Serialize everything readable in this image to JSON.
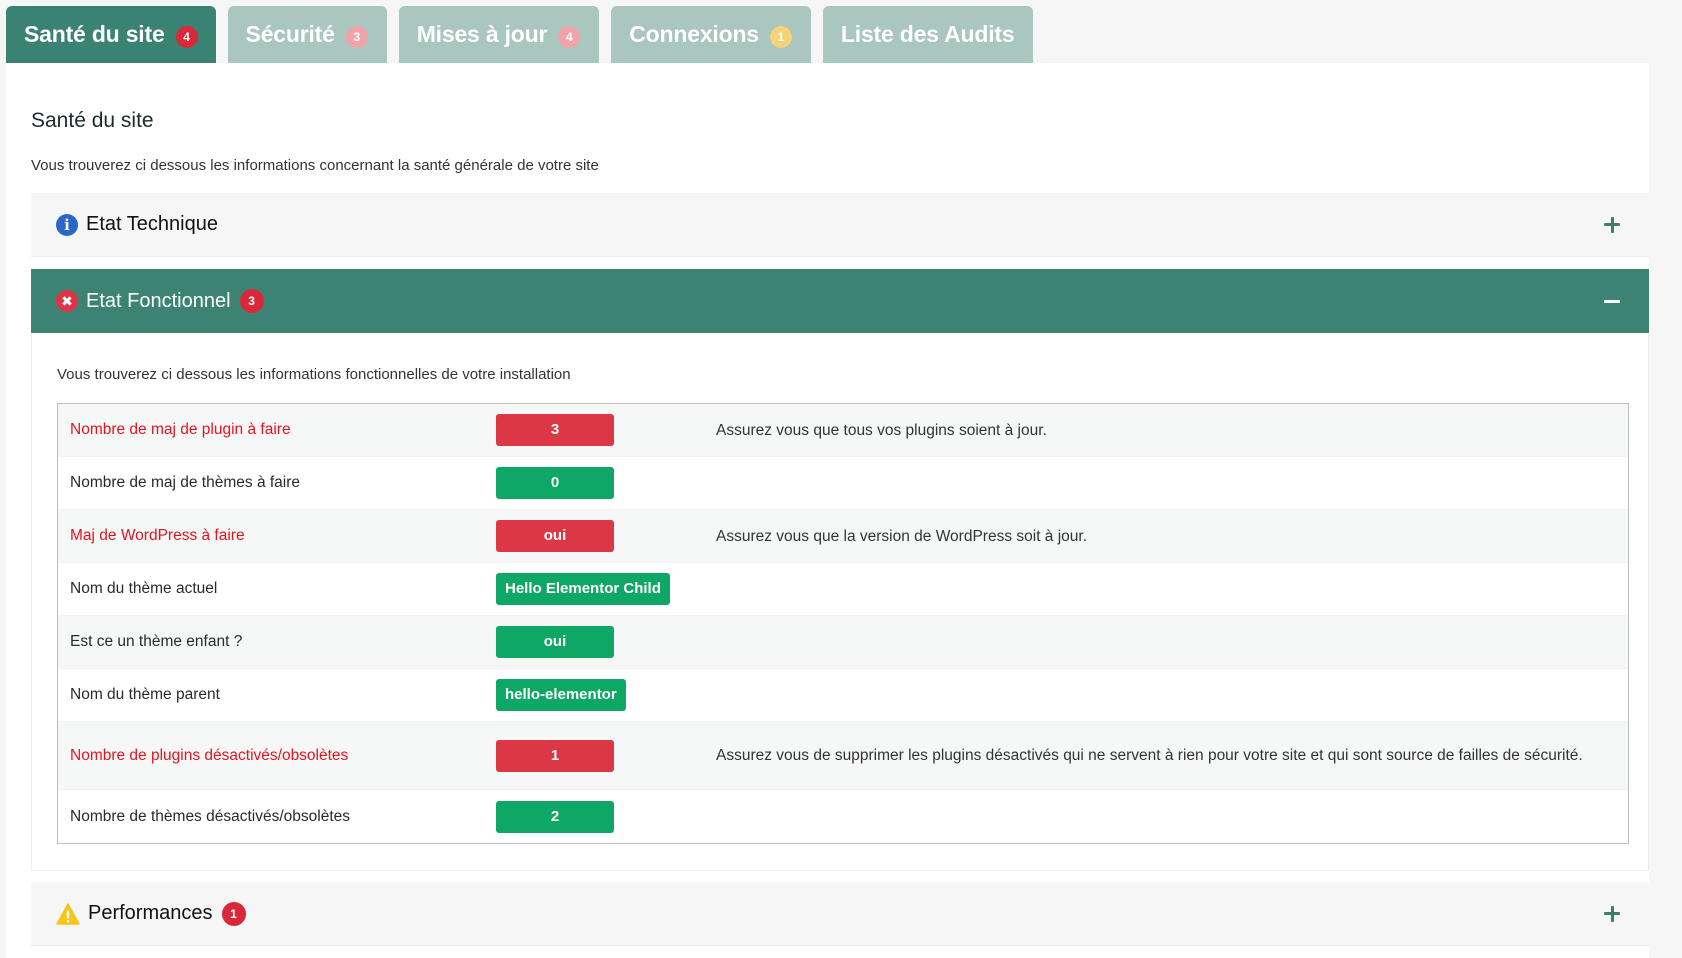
{
  "tabs": [
    {
      "label": "Santé du site",
      "badge": "4",
      "badge_style": "red",
      "active": true
    },
    {
      "label": "Sécurité",
      "badge": "3",
      "badge_style": "pink",
      "active": false
    },
    {
      "label": "Mises à jour",
      "badge": "4",
      "badge_style": "pink",
      "active": false
    },
    {
      "label": "Connexions",
      "badge": "1",
      "badge_style": "yellow",
      "active": false
    },
    {
      "label": "Liste des Audits",
      "badge": "",
      "badge_style": "",
      "active": false
    }
  ],
  "page": {
    "title": "Santé du site",
    "description": "Vous trouverez ci dessous les informations concernant la santé générale de votre site"
  },
  "sections": {
    "technique": {
      "title": "Etat Technique",
      "icon": "info-icon",
      "expanded": false
    },
    "fonctionnel": {
      "title": "Etat Fonctionnel",
      "icon": "error-icon",
      "badge": "3",
      "expanded": true,
      "description": "Vous trouverez ci dessous les informations fonctionnelles de votre installation",
      "rows": [
        {
          "label": "Nombre de maj de plugin à faire",
          "value": "3",
          "status": "red",
          "note": "Assurez vous que tous vos plugins soient à jour."
        },
        {
          "label": "Nombre de maj de thèmes à faire",
          "value": "0",
          "status": "green",
          "note": ""
        },
        {
          "label": "Maj de WordPress à faire",
          "value": "oui",
          "status": "red",
          "note": "Assurez vous que la version de WordPress soit à jour."
        },
        {
          "label": "Nom du thème actuel",
          "value": "Hello Elementor Child",
          "status": "green",
          "note": ""
        },
        {
          "label": "Est ce un thème enfant ?",
          "value": "oui",
          "status": "green",
          "note": ""
        },
        {
          "label": "Nom du thème parent",
          "value": "hello-elementor",
          "status": "green",
          "note": ""
        },
        {
          "label": "Nombre de plugins désactivés/obsolètes",
          "value": "1",
          "status": "red",
          "note": "Assurez vous de supprimer les plugins désactivés qui ne servent à rien pour votre site et qui sont source de failles de sécurité."
        },
        {
          "label": "Nombre de thèmes désactivés/obsolètes",
          "value": "2",
          "status": "green",
          "note": ""
        }
      ]
    },
    "performances": {
      "title": "Performances",
      "icon": "warning-icon",
      "badge": "1",
      "expanded": false
    }
  },
  "colors": {
    "accent": "#3c8374",
    "tab_inactive": "#a9c6bf",
    "danger": "#dc3744",
    "success": "#0fa765",
    "warning_text": "#e3141f"
  }
}
